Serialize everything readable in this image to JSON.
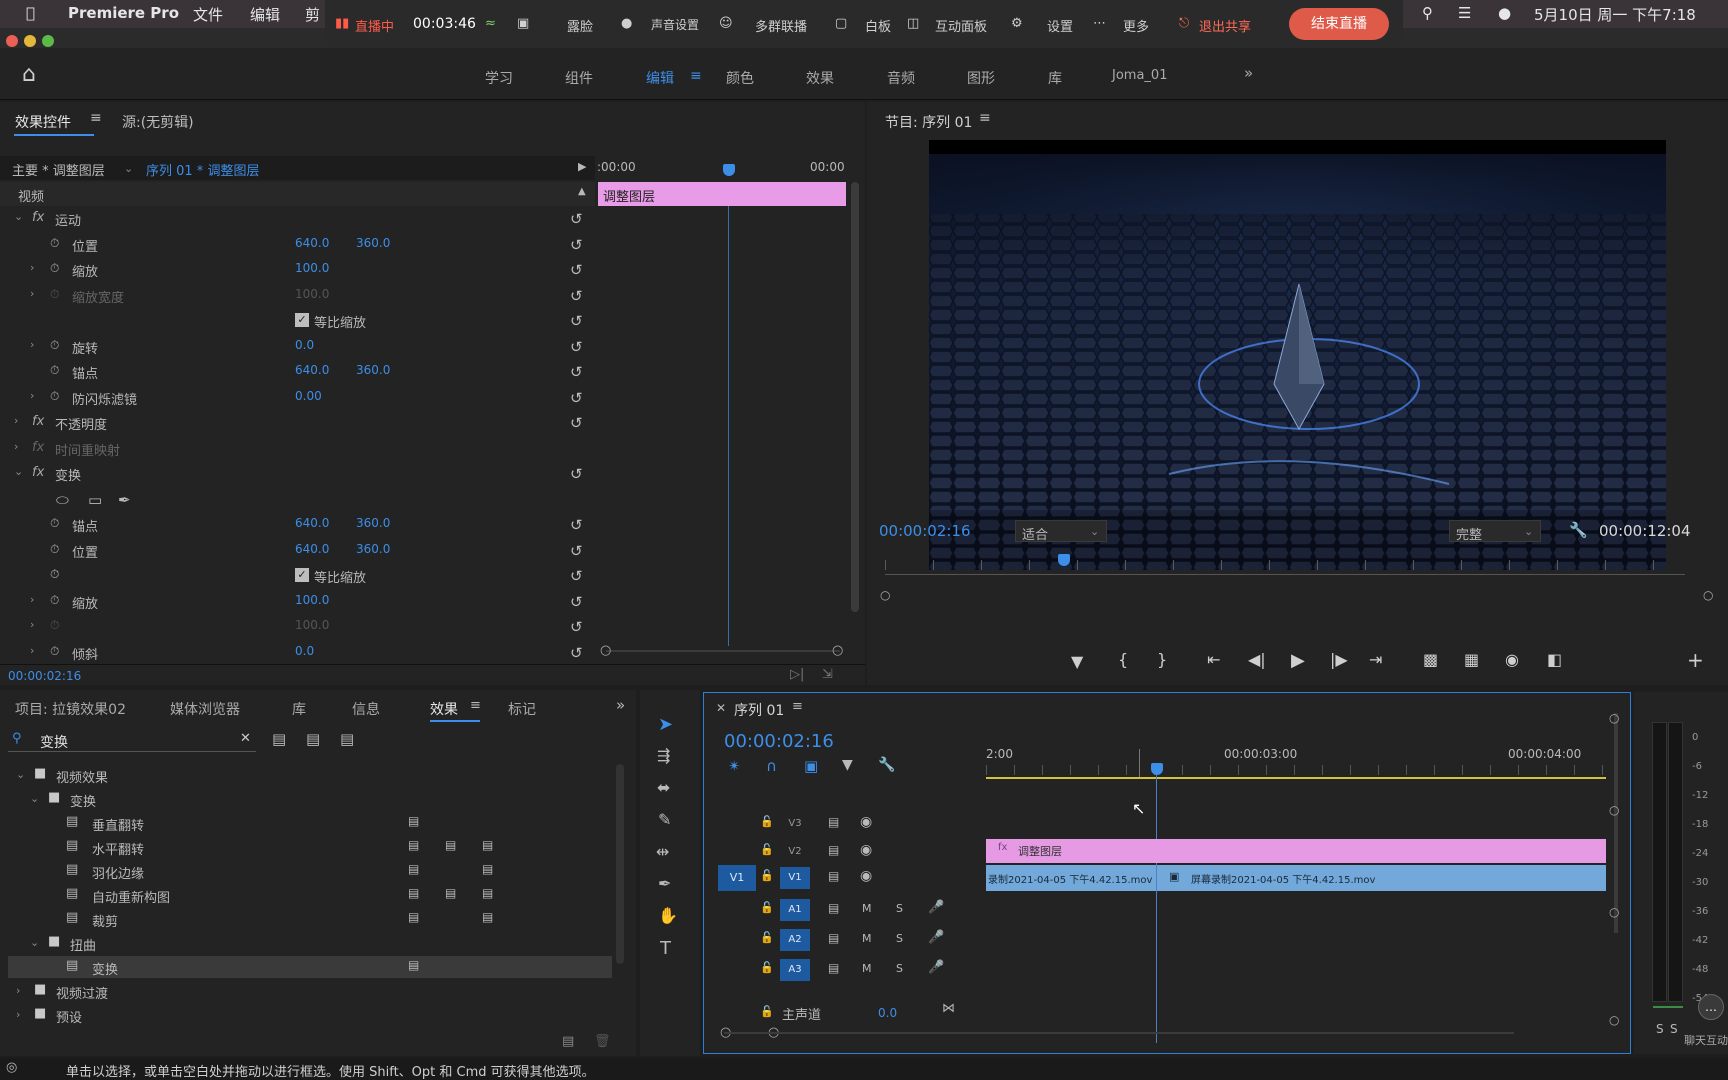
{
  "menubar": {
    "app": "Premiere Pro",
    "items": [
      "文件",
      "编辑",
      "剪"
    ],
    "clock": "5月10日 周一 下午7:18"
  },
  "livebar": {
    "status": "直播中",
    "elapsed": "00:03:46",
    "items": [
      "露脸",
      "声音设置",
      "多群联播",
      "白板",
      "互动面板",
      "设置",
      "更多"
    ],
    "exit_share": "退出共享",
    "end_live": "结束直播"
  },
  "workspaces": [
    "学习",
    "组件",
    "编辑",
    "颜色",
    "效果",
    "音频",
    "图形",
    "库",
    "Joma_01"
  ],
  "effect_controls": {
    "tab_active": "效果控件",
    "tab_source": "源:(无剪辑)",
    "master": "主要 * 调整图层",
    "sequence": "序列 01 * 调整图层",
    "ruler_start": ":00:00",
    "ruler_end": "00:00",
    "clip_label": "调整图层",
    "section": "视频",
    "rows": [
      {
        "label": "运动",
        "v1": "",
        "v2": ""
      },
      {
        "label": "位置",
        "v1": "640.0",
        "v2": "360.0"
      },
      {
        "label": "缩放",
        "v1": "100.0",
        "v2": ""
      },
      {
        "label": "缩放宽度",
        "v1": "100.0",
        "v2": ""
      },
      {
        "label": "等比缩放",
        "v1": "",
        "v2": ""
      },
      {
        "label": "旋转",
        "v1": "0.0",
        "v2": ""
      },
      {
        "label": "锚点",
        "v1": "640.0",
        "v2": "360.0"
      },
      {
        "label": "防闪烁滤镜",
        "v1": "0.00",
        "v2": ""
      },
      {
        "label": "不透明度",
        "v1": "",
        "v2": ""
      },
      {
        "label": "时间重映射",
        "v1": "",
        "v2": ""
      },
      {
        "label": "变换",
        "v1": "",
        "v2": ""
      },
      {
        "label": "",
        "v1": "",
        "v2": ""
      },
      {
        "label": "锚点",
        "v1": "640.0",
        "v2": "360.0"
      },
      {
        "label": "位置",
        "v1": "640.0",
        "v2": "360.0"
      },
      {
        "label": "等比缩放",
        "v1": "",
        "v2": ""
      },
      {
        "label": "缩放",
        "v1": "100.0",
        "v2": ""
      },
      {
        "label": "",
        "v1": "100.0",
        "v2": ""
      },
      {
        "label": "倾斜",
        "v1": "0.0",
        "v2": ""
      }
    ],
    "timecode": "00:00:02:16"
  },
  "program": {
    "title": "节目: 序列 01",
    "timecode": "00:00:02:16",
    "fit": "适合",
    "quality": "完整",
    "duration": "00:00:12:04"
  },
  "project": {
    "tabs": [
      "项目: 拉镜效果02",
      "媒体浏览器",
      "库",
      "信息",
      "效果",
      "标记"
    ],
    "search": "变换",
    "tree": [
      {
        "label": "视频效果",
        "level": 0,
        "type": "folder",
        "open": true
      },
      {
        "label": "变换",
        "level": 1,
        "type": "folder",
        "open": true
      },
      {
        "label": "垂直翻转",
        "level": 2,
        "type": "fx"
      },
      {
        "label": "水平翻转",
        "level": 2,
        "type": "fx"
      },
      {
        "label": "羽化边缘",
        "level": 2,
        "type": "fx"
      },
      {
        "label": "自动重新构图",
        "level": 2,
        "type": "fx"
      },
      {
        "label": "裁剪",
        "level": 2,
        "type": "fx"
      },
      {
        "label": "扭曲",
        "level": 1,
        "type": "folder",
        "open": true
      },
      {
        "label": "变换",
        "level": 2,
        "type": "fx",
        "selected": true
      },
      {
        "label": "视频过渡",
        "level": 0,
        "type": "folder",
        "open": false
      },
      {
        "label": "预设",
        "level": 0,
        "type": "folder",
        "open": false
      }
    ]
  },
  "timeline": {
    "title": "序列 01",
    "timecode": "00:00:02:16",
    "ruler": [
      "2:00",
      "00:00:03:00",
      "00:00:04:00"
    ],
    "tracks_v": [
      "V3",
      "V2",
      "V1"
    ],
    "source_v": "V1",
    "tracks_a": [
      "A1",
      "A2",
      "A3"
    ],
    "master": "主声道",
    "master_val": "0.0",
    "clip_adjust": "调整图层",
    "clip_a": "录制2021-04-05 下午4.42.15.mov",
    "clip_b": "屏幕录制2021-04-05 下午4.42.15.mov"
  },
  "meter": {
    "ticks": [
      "0",
      "-6",
      "-12",
      "-18",
      "-24",
      "-30",
      "-36",
      "-42",
      "-48",
      "-54"
    ],
    "chat": "聊天互动"
  },
  "statusbar": {
    "text": "单击以选择，或单击空白处并拖动以进行框选。使用 Shift、Opt 和 Cmd 可获得其他选项。"
  },
  "colors": {
    "accent": "#2d8ceb",
    "clip_pink": "#e58fe0",
    "clip_blue": "#6fa6d8"
  }
}
